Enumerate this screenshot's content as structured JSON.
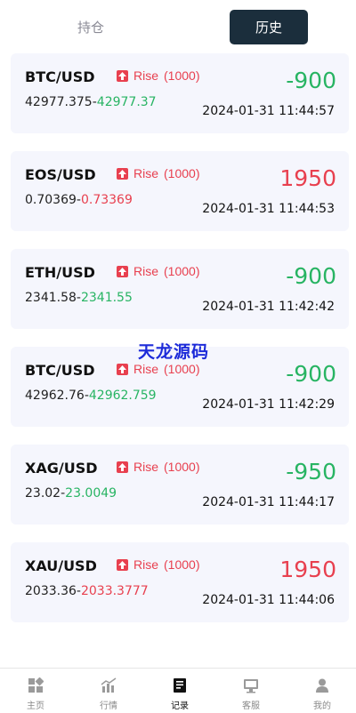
{
  "tabs": [
    {
      "label": "持仓",
      "active": false
    },
    {
      "label": "历史",
      "active": true
    }
  ],
  "orders": [
    {
      "pair": "BTC/USD",
      "direction": "Rise",
      "amount": "(1000)",
      "open": "42977.375",
      "sep": "-",
      "close": "42977.37",
      "close_color": "green",
      "pnl": "-900",
      "pnl_color": "green",
      "time": "2024-01-31 11:44:57"
    },
    {
      "pair": "EOS/USD",
      "direction": "Rise",
      "amount": "(1000)",
      "open": "0.70369",
      "sep": "-",
      "close": "0.73369",
      "close_color": "red",
      "pnl": "1950",
      "pnl_color": "red",
      "time": "2024-01-31 11:44:53"
    },
    {
      "pair": "ETH/USD",
      "direction": "Rise",
      "amount": "(1000)",
      "open": "2341.58",
      "sep": "-",
      "close": "2341.55",
      "close_color": "green",
      "pnl": "-900",
      "pnl_color": "green",
      "time": "2024-01-31 11:42:42"
    },
    {
      "pair": "BTC/USD",
      "direction": "Rise",
      "amount": "(1000)",
      "open": "42962.76",
      "sep": "-",
      "close": "42962.759",
      "close_color": "green",
      "pnl": "-900",
      "pnl_color": "green",
      "time": "2024-01-31 11:42:29"
    },
    {
      "pair": "XAG/USD",
      "direction": "Rise",
      "amount": "(1000)",
      "open": "23.02",
      "sep": "-",
      "close": "23.0049",
      "close_color": "green",
      "pnl": "-950",
      "pnl_color": "green",
      "time": "2024-01-31 11:44:17"
    },
    {
      "pair": "XAU/USD",
      "direction": "Rise",
      "amount": "(1000)",
      "open": "2033.36",
      "sep": "-",
      "close": "2033.3777",
      "close_color": "red",
      "pnl": "1950",
      "pnl_color": "red",
      "time": "2024-01-31 11:44:06"
    }
  ],
  "watermark": "天龙源码",
  "bottom_nav": [
    {
      "label": "主页",
      "icon": "home-grid-icon",
      "active": false
    },
    {
      "label": "行情",
      "icon": "market-chart-icon",
      "active": false
    },
    {
      "label": "记录",
      "icon": "records-icon",
      "active": true
    },
    {
      "label": "客服",
      "icon": "support-icon",
      "active": false
    },
    {
      "label": "我的",
      "icon": "user-icon",
      "active": false
    }
  ],
  "colors": {
    "up": "#28b463",
    "down": "#e8404f",
    "active_tab_bg": "#1b2e3c",
    "card_bg": "#f5f6fd"
  }
}
